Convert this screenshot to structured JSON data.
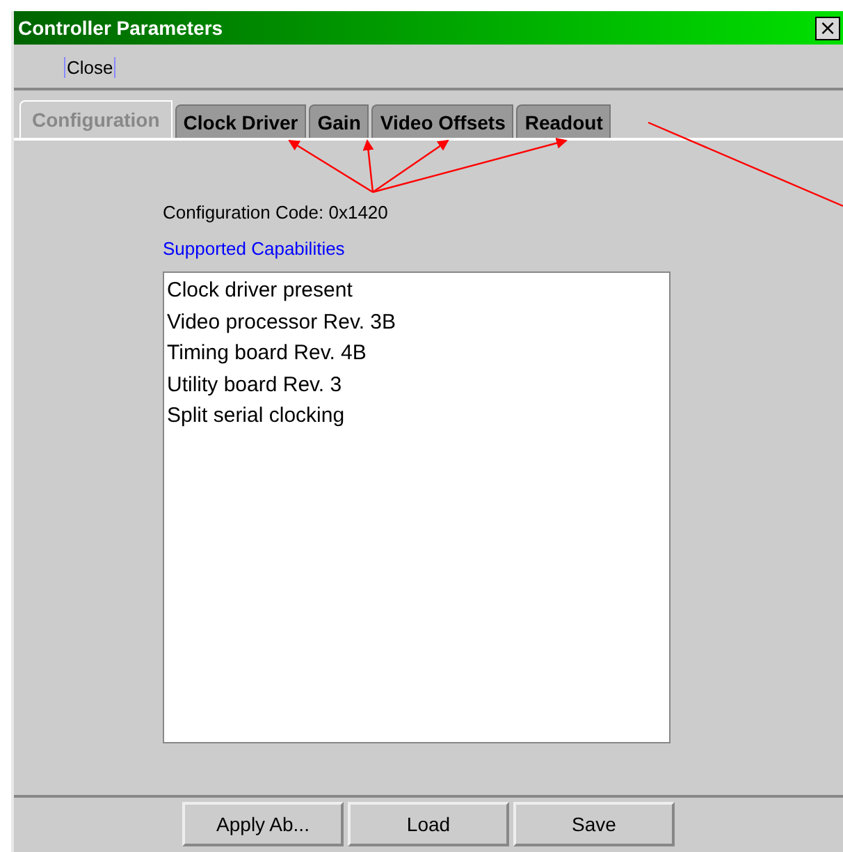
{
  "window": {
    "title": "Controller Parameters",
    "close_glyph": "×"
  },
  "menu": [
    "Close"
  ],
  "tabs": [
    {
      "label": "Configuration",
      "selected": true
    },
    {
      "label": "Clock Driver",
      "selected": false
    },
    {
      "label": "Gain",
      "selected": false
    },
    {
      "label": "Video Offsets",
      "selected": false
    },
    {
      "label": "Readout",
      "selected": false
    }
  ],
  "configuration_code": "Configuration Code: 0x1420",
  "capabilities_heading": "Supported Capabilities",
  "capabilities": [
    "Clock driver present",
    "Video processor Rev. 3B",
    "Timing board Rev. 4B",
    "Utility board Rev. 3",
    "Split serial clocking"
  ],
  "buttons": [
    "Apply Ab...",
    "Load",
    "Save"
  ]
}
